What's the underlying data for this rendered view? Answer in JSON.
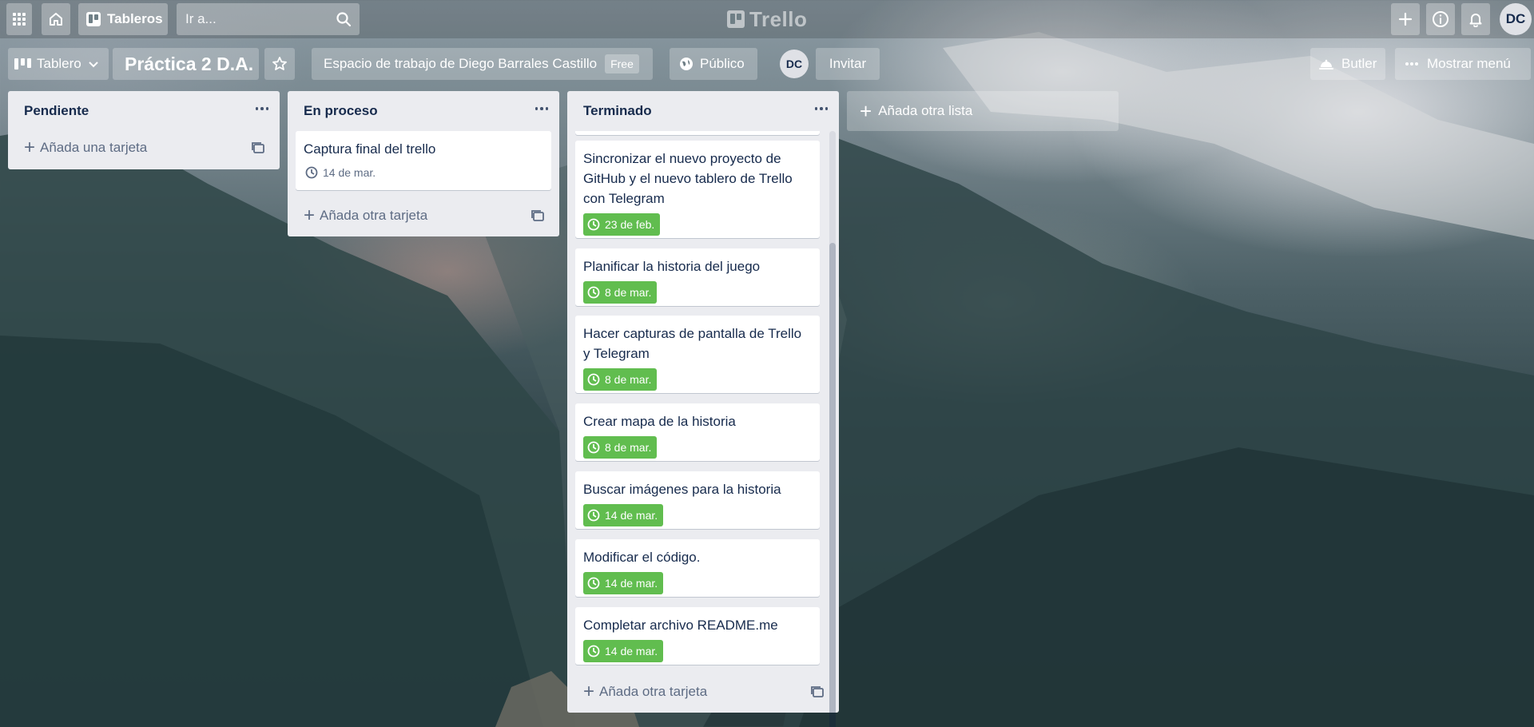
{
  "header": {
    "apps_icon": "grid-icon",
    "home_icon": "house-icon",
    "boards_label": "Tableros",
    "search_placeholder": "Ir a...",
    "logo_text": "Trello",
    "create_icon": "plus-icon",
    "info_icon": "info-icon",
    "notifications_icon": "bell-icon",
    "avatar_initials": "DC"
  },
  "board": {
    "view_label": "Tablero",
    "title": "Práctica 2 D.A.",
    "workspace_label": "Espacio de trabajo de Diego Barrales Castillo",
    "plan_badge": "Free",
    "visibility_label": "Público",
    "member_initials": "DC",
    "invite_label": "Invitar",
    "butler_label": "Butler",
    "show_menu_label": "Mostrar menú"
  },
  "lists": [
    {
      "name": "Pendiente",
      "cards": [],
      "composer_label": "Añada una tarjeta"
    },
    {
      "name": "En proceso",
      "cards": [
        {
          "title": "Captura final del trello",
          "due": "14 de mar.",
          "complete": false
        }
      ],
      "composer_label": "Añada otra tarjeta"
    },
    {
      "name": "Terminado",
      "cards": [
        {
          "title": "Sincronizar el nuevo proyecto de GitHub y el nuevo tablero de Trello con Telegram",
          "due": "23 de feb.",
          "complete": true
        },
        {
          "title": "Planificar la historia del juego",
          "due": "8 de mar.",
          "complete": true
        },
        {
          "title": "Hacer capturas de pantalla de Trello y Telegram",
          "due": "8 de mar.",
          "complete": true
        },
        {
          "title": "Crear mapa de la historia",
          "due": "8 de mar.",
          "complete": true
        },
        {
          "title": "Buscar imágenes para la historia",
          "due": "14 de mar.",
          "complete": true
        },
        {
          "title": "Modificar el código.",
          "due": "14 de mar.",
          "complete": true
        },
        {
          "title": "Completar archivo README.me",
          "due": "14 de mar.",
          "complete": true
        }
      ],
      "composer_label": "Añada otra tarjeta"
    }
  ],
  "add_list_label": "Añada otra lista",
  "colors": {
    "list_bg": "#ebecf0",
    "due_complete": "#61bd4f",
    "text": "#172b4d"
  }
}
